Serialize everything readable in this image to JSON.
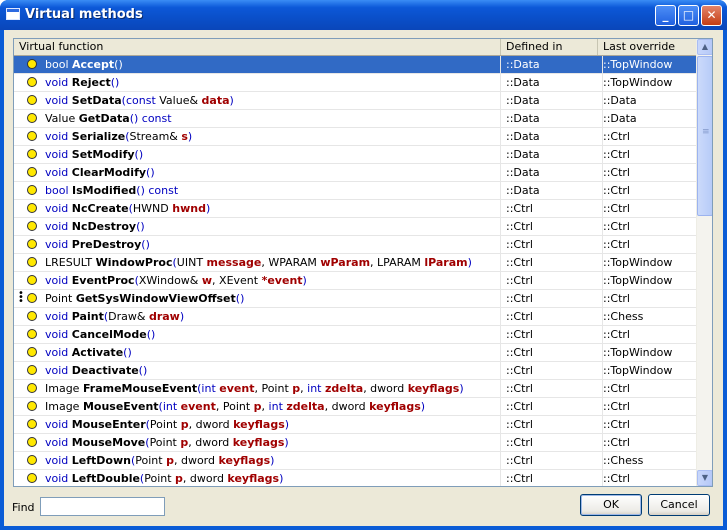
{
  "window": {
    "title": "Virtual methods"
  },
  "title_buttons": {
    "minimize": "_",
    "maximize": "□",
    "close": "✕"
  },
  "columns": [
    "Virtual function",
    "Defined in",
    "Last override"
  ],
  "rows": [
    {
      "selected": true,
      "tokens": [
        [
          "kw",
          "bool "
        ],
        [
          "nm",
          "Accept"
        ],
        [
          "pu",
          "()"
        ]
      ],
      "defined_in": "::Data",
      "last_override": "::TopWindow"
    },
    {
      "tokens": [
        [
          "kw",
          "void "
        ],
        [
          "nm",
          "Reject"
        ],
        [
          "pu",
          "()"
        ]
      ],
      "defined_in": "::Data",
      "last_override": "::TopWindow"
    },
    {
      "tokens": [
        [
          "kw",
          "void "
        ],
        [
          "nm",
          "SetData"
        ],
        [
          "pu",
          "("
        ],
        [
          "kw",
          "const "
        ],
        [
          "ty",
          "Value& "
        ],
        [
          "pa",
          "data"
        ],
        [
          "pu",
          ")"
        ]
      ],
      "defined_in": "::Data",
      "last_override": "::Data"
    },
    {
      "tokens": [
        [
          "ty",
          "Value "
        ],
        [
          "nm",
          "GetData"
        ],
        [
          "pu",
          "() const"
        ]
      ],
      "defined_in": "::Data",
      "last_override": "::Data"
    },
    {
      "tokens": [
        [
          "kw",
          "void "
        ],
        [
          "nm",
          "Serialize"
        ],
        [
          "pu",
          "("
        ],
        [
          "ty",
          "Stream& "
        ],
        [
          "pa",
          "s"
        ],
        [
          "pu",
          ")"
        ]
      ],
      "defined_in": "::Data",
      "last_override": "::Ctrl"
    },
    {
      "tokens": [
        [
          "kw",
          "void "
        ],
        [
          "nm",
          "SetModify"
        ],
        [
          "pu",
          "()"
        ]
      ],
      "defined_in": "::Data",
      "last_override": "::Ctrl"
    },
    {
      "tokens": [
        [
          "kw",
          "void "
        ],
        [
          "nm",
          "ClearModify"
        ],
        [
          "pu",
          "()"
        ]
      ],
      "defined_in": "::Data",
      "last_override": "::Ctrl"
    },
    {
      "tokens": [
        [
          "kw",
          "bool "
        ],
        [
          "nm",
          "IsModified"
        ],
        [
          "pu",
          "() const"
        ]
      ],
      "defined_in": "::Data",
      "last_override": "::Ctrl"
    },
    {
      "tokens": [
        [
          "kw",
          "void "
        ],
        [
          "nm",
          "NcCreate"
        ],
        [
          "pu",
          "("
        ],
        [
          "ty",
          "HWND "
        ],
        [
          "pa",
          "hwnd"
        ],
        [
          "pu",
          ")"
        ]
      ],
      "defined_in": "::Ctrl",
      "last_override": "::Ctrl"
    },
    {
      "tokens": [
        [
          "kw",
          "void "
        ],
        [
          "nm",
          "NcDestroy"
        ],
        [
          "pu",
          "()"
        ]
      ],
      "defined_in": "::Ctrl",
      "last_override": "::Ctrl"
    },
    {
      "tokens": [
        [
          "kw",
          "void "
        ],
        [
          "nm",
          "PreDestroy"
        ],
        [
          "pu",
          "()"
        ]
      ],
      "defined_in": "::Ctrl",
      "last_override": "::Ctrl"
    },
    {
      "tokens": [
        [
          "ty",
          "LRESULT "
        ],
        [
          "nm",
          "WindowProc"
        ],
        [
          "pu",
          "("
        ],
        [
          "ty",
          "UINT "
        ],
        [
          "pa",
          "message"
        ],
        [
          "ty",
          ", WPARAM "
        ],
        [
          "pa",
          "wParam"
        ],
        [
          "ty",
          ", LPARAM "
        ],
        [
          "pa",
          "lParam"
        ],
        [
          "pu",
          ")"
        ]
      ],
      "defined_in": "::Ctrl",
      "last_override": "::TopWindow"
    },
    {
      "tokens": [
        [
          "kw",
          "void "
        ],
        [
          "nm",
          "EventProc"
        ],
        [
          "pu",
          "("
        ],
        [
          "ty",
          "XWindow& "
        ],
        [
          "pa",
          "w"
        ],
        [
          "ty",
          ", XEvent "
        ],
        [
          "pa",
          "*event"
        ],
        [
          "pu",
          ")"
        ]
      ],
      "defined_in": "::Ctrl",
      "last_override": "::TopWindow"
    },
    {
      "grip": true,
      "tokens": [
        [
          "ty",
          "Point "
        ],
        [
          "nm",
          "GetSysWindowViewOffset"
        ],
        [
          "pu",
          "()"
        ]
      ],
      "defined_in": "::Ctrl",
      "last_override": "::Ctrl"
    },
    {
      "tokens": [
        [
          "kw",
          "void "
        ],
        [
          "nm",
          "Paint"
        ],
        [
          "pu",
          "("
        ],
        [
          "ty",
          "Draw& "
        ],
        [
          "pa",
          "draw"
        ],
        [
          "pu",
          ")"
        ]
      ],
      "defined_in": "::Ctrl",
      "last_override": "::Chess"
    },
    {
      "tokens": [
        [
          "kw",
          "void "
        ],
        [
          "nm",
          "CancelMode"
        ],
        [
          "pu",
          "()"
        ]
      ],
      "defined_in": "::Ctrl",
      "last_override": "::Ctrl"
    },
    {
      "tokens": [
        [
          "kw",
          "void "
        ],
        [
          "nm",
          "Activate"
        ],
        [
          "pu",
          "()"
        ]
      ],
      "defined_in": "::Ctrl",
      "last_override": "::TopWindow"
    },
    {
      "tokens": [
        [
          "kw",
          "void "
        ],
        [
          "nm",
          "Deactivate"
        ],
        [
          "pu",
          "()"
        ]
      ],
      "defined_in": "::Ctrl",
      "last_override": "::TopWindow"
    },
    {
      "tokens": [
        [
          "ty",
          "Image "
        ],
        [
          "nm",
          "FrameMouseEvent"
        ],
        [
          "pu",
          "("
        ],
        [
          "kw",
          "int "
        ],
        [
          "pa",
          "event"
        ],
        [
          "ty",
          ", Point "
        ],
        [
          "pa",
          "p"
        ],
        [
          "ty",
          ", "
        ],
        [
          "kw",
          "int "
        ],
        [
          "pa",
          "zdelta"
        ],
        [
          "ty",
          ", dword "
        ],
        [
          "pa",
          "keyflags"
        ],
        [
          "pu",
          ")"
        ]
      ],
      "defined_in": "::Ctrl",
      "last_override": "::Ctrl"
    },
    {
      "tokens": [
        [
          "ty",
          "Image "
        ],
        [
          "nm",
          "MouseEvent"
        ],
        [
          "pu",
          "("
        ],
        [
          "kw",
          "int "
        ],
        [
          "pa",
          "event"
        ],
        [
          "ty",
          ", Point "
        ],
        [
          "pa",
          "p"
        ],
        [
          "ty",
          ", "
        ],
        [
          "kw",
          "int "
        ],
        [
          "pa",
          "zdelta"
        ],
        [
          "ty",
          ", dword "
        ],
        [
          "pa",
          "keyflags"
        ],
        [
          "pu",
          ")"
        ]
      ],
      "defined_in": "::Ctrl",
      "last_override": "::Ctrl"
    },
    {
      "tokens": [
        [
          "kw",
          "void "
        ],
        [
          "nm",
          "MouseEnter"
        ],
        [
          "pu",
          "("
        ],
        [
          "ty",
          "Point "
        ],
        [
          "pa",
          "p"
        ],
        [
          "ty",
          ", dword "
        ],
        [
          "pa",
          "keyflags"
        ],
        [
          "pu",
          ")"
        ]
      ],
      "defined_in": "::Ctrl",
      "last_override": "::Ctrl"
    },
    {
      "tokens": [
        [
          "kw",
          "void "
        ],
        [
          "nm",
          "MouseMove"
        ],
        [
          "pu",
          "("
        ],
        [
          "ty",
          "Point "
        ],
        [
          "pa",
          "p"
        ],
        [
          "ty",
          ", dword "
        ],
        [
          "pa",
          "keyflags"
        ],
        [
          "pu",
          ")"
        ]
      ],
      "defined_in": "::Ctrl",
      "last_override": "::Ctrl"
    },
    {
      "tokens": [
        [
          "kw",
          "void "
        ],
        [
          "nm",
          "LeftDown"
        ],
        [
          "pu",
          "("
        ],
        [
          "ty",
          "Point "
        ],
        [
          "pa",
          "p"
        ],
        [
          "ty",
          ", dword "
        ],
        [
          "pa",
          "keyflags"
        ],
        [
          "pu",
          ")"
        ]
      ],
      "defined_in": "::Ctrl",
      "last_override": "::Chess"
    },
    {
      "tokens": [
        [
          "kw",
          "void "
        ],
        [
          "nm",
          "LeftDouble"
        ],
        [
          "pu",
          "("
        ],
        [
          "ty",
          "Point "
        ],
        [
          "pa",
          "p"
        ],
        [
          "ty",
          ", dword "
        ],
        [
          "pa",
          "keyflags"
        ],
        [
          "pu",
          ")"
        ]
      ],
      "defined_in": "::Ctrl",
      "last_override": "::Ctrl"
    }
  ],
  "scrollbar": {
    "up": "▲",
    "down": "▼",
    "grip": "≡"
  },
  "find": {
    "label": "Find",
    "value": ""
  },
  "buttons": {
    "ok": "OK",
    "cancel": "Cancel"
  }
}
